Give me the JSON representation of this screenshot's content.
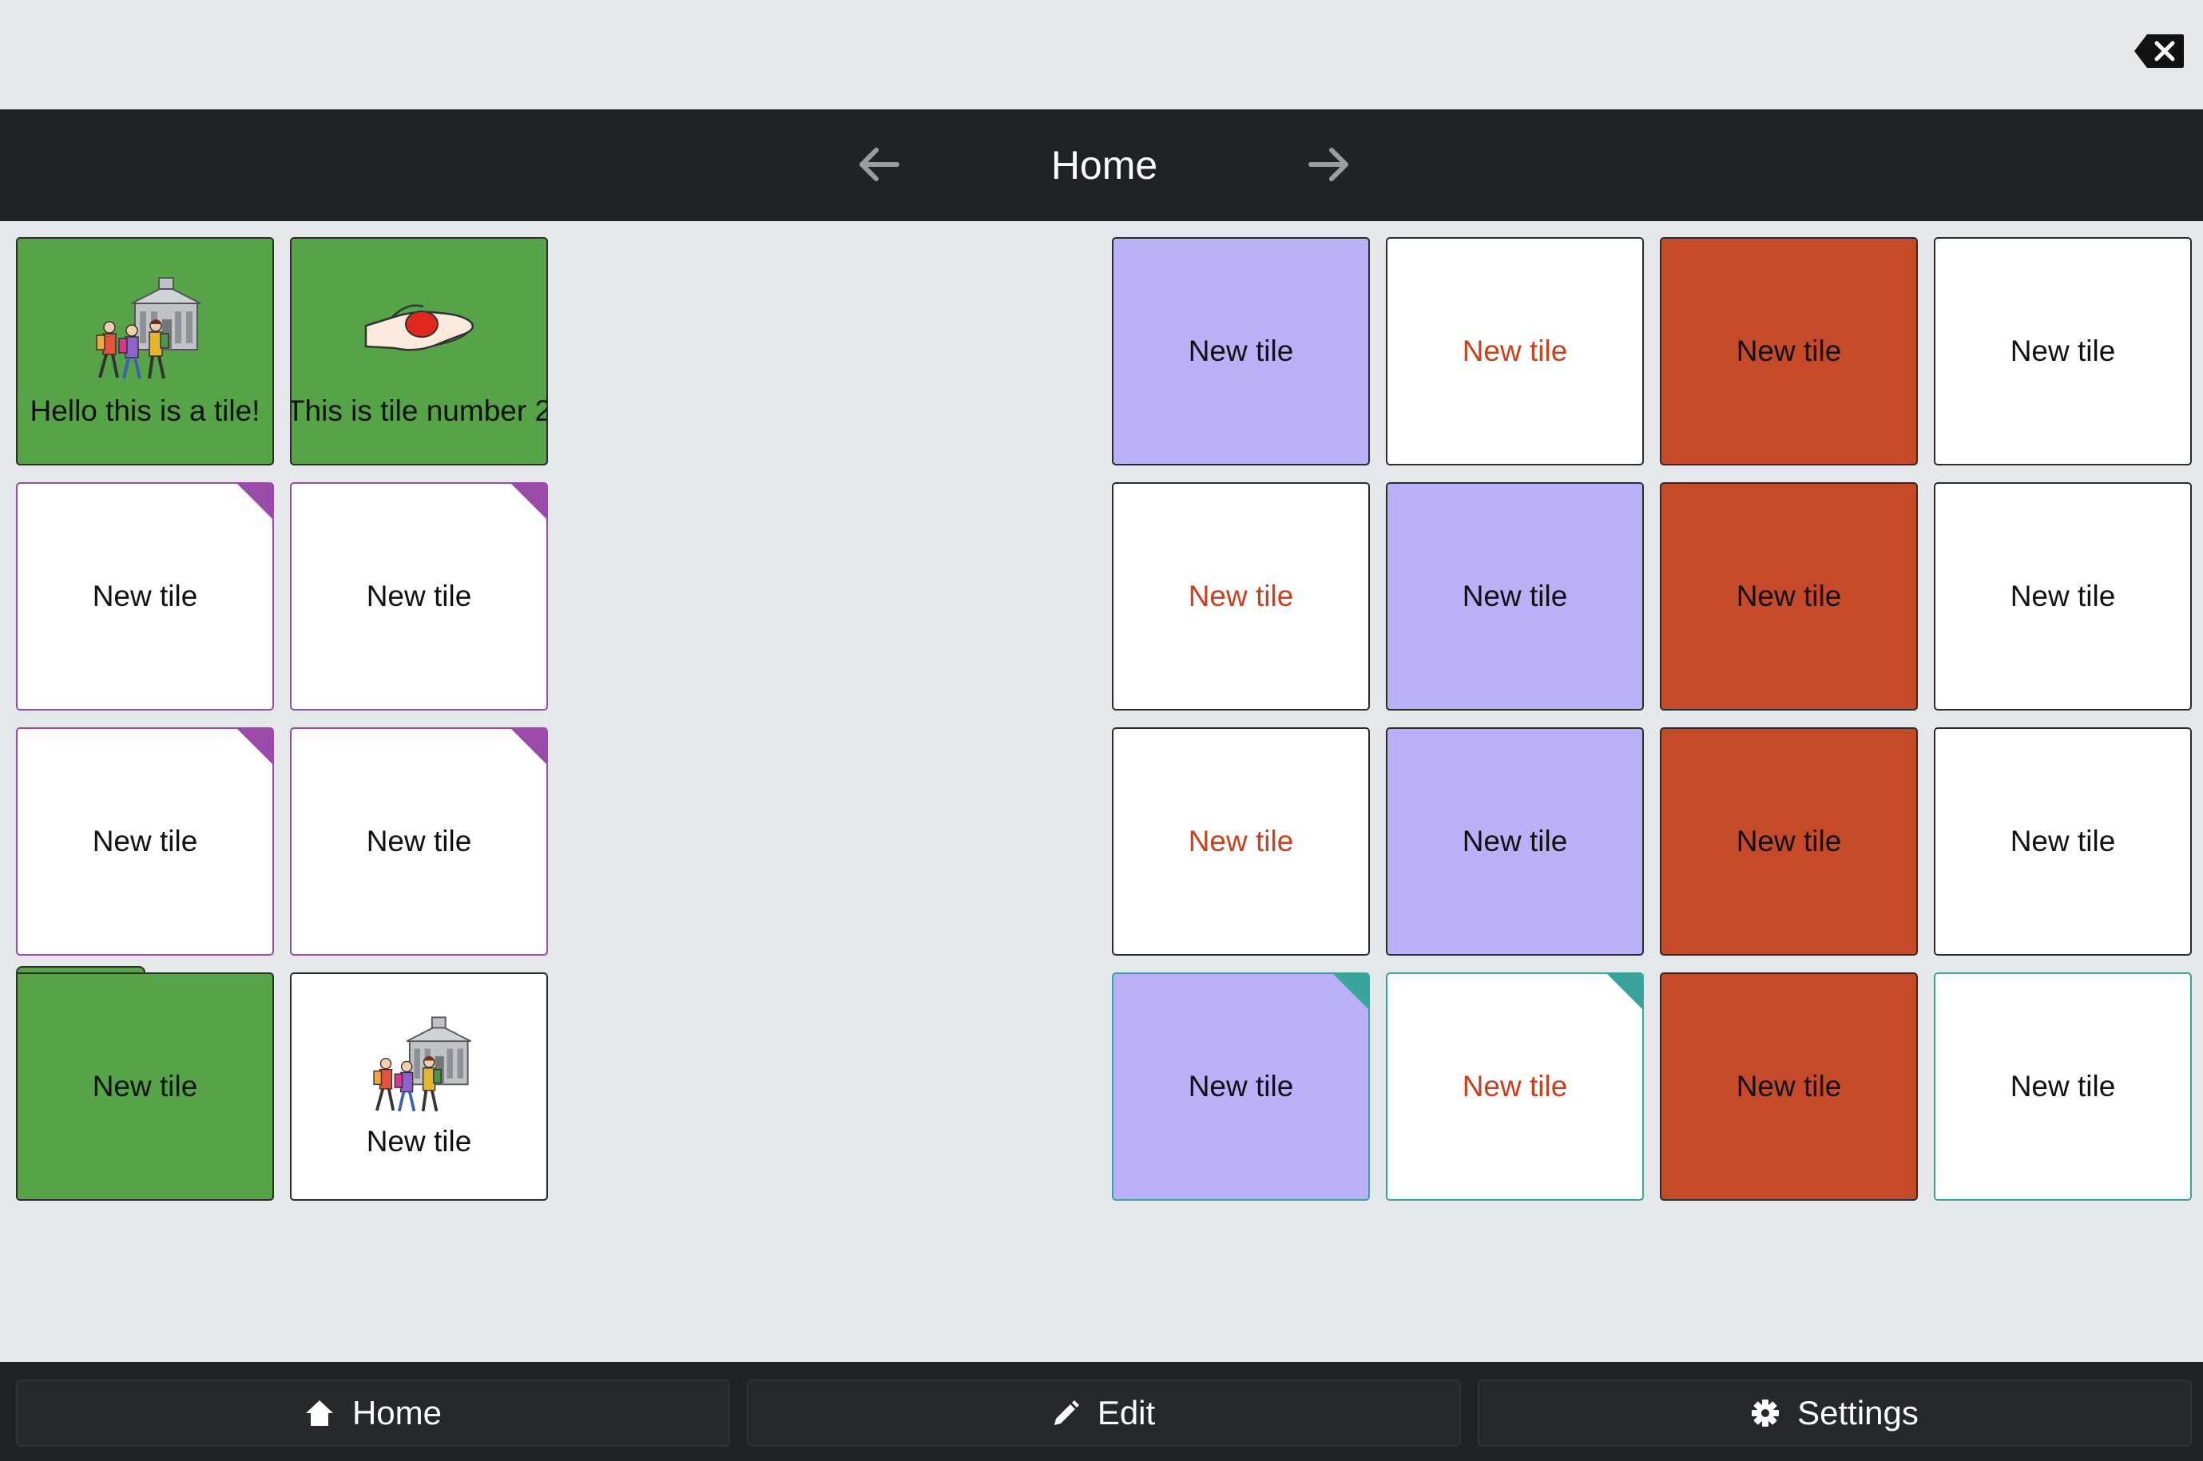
{
  "header": {
    "title": "Home",
    "back_icon": "arrow-left-icon",
    "forward_icon": "arrow-right-icon",
    "backspace_icon": "backspace-icon"
  },
  "colors": {
    "green": "#56a447",
    "purple_tile": "#b9b0f7",
    "red_tile": "#c44a2a",
    "red_text": "#c9401d",
    "corner_purple": "#9a4aa8",
    "corner_teal": "#3aa39b"
  },
  "left_tiles": [
    {
      "label": "Hello this is a tile!",
      "image": "students-school-picture"
    },
    {
      "label": "This is tile number 2",
      "image": "hand-giving-picture"
    },
    {
      "label": "New tile"
    },
    {
      "label": "New tile"
    },
    {
      "label": "New tile"
    },
    {
      "label": "New tile"
    },
    {
      "label": "New tile"
    },
    {
      "label": "New tile",
      "image": "students-school-picture"
    }
  ],
  "right_tiles": [
    {
      "label": "New tile"
    },
    {
      "label": "New tile"
    },
    {
      "label": "New tile"
    },
    {
      "label": "New tile"
    },
    {
      "label": "New tile"
    },
    {
      "label": "New tile"
    },
    {
      "label": "New tile"
    },
    {
      "label": "New tile"
    },
    {
      "label": "New tile"
    },
    {
      "label": "New tile"
    },
    {
      "label": "New tile"
    },
    {
      "label": "New tile"
    },
    {
      "label": "New tile"
    },
    {
      "label": "New tile"
    },
    {
      "label": "New tile"
    },
    {
      "label": "New tile"
    }
  ],
  "bottom_nav": {
    "home": {
      "label": "Home",
      "icon": "home-icon"
    },
    "edit": {
      "label": "Edit",
      "icon": "pencil-icon"
    },
    "settings": {
      "label": "Settings",
      "icon": "gear-icon"
    }
  }
}
